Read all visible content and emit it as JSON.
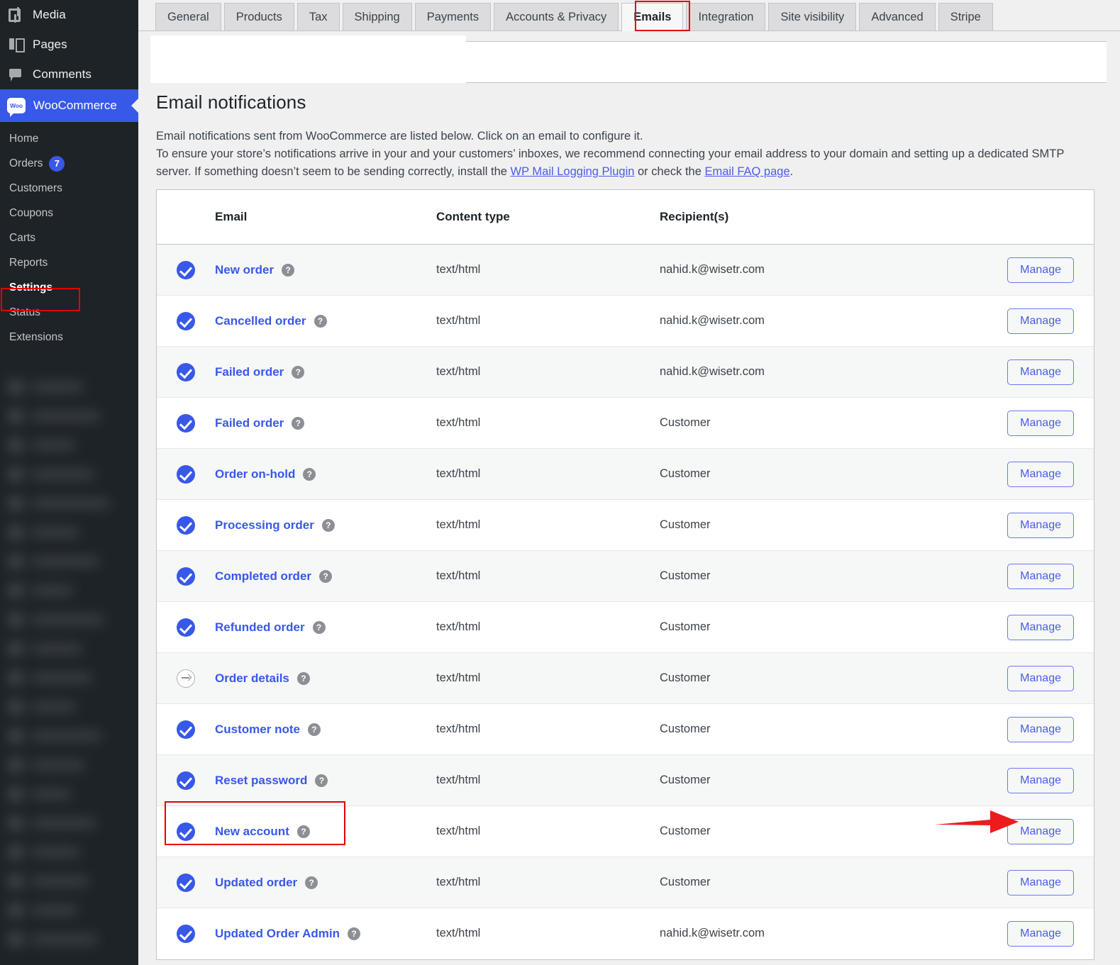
{
  "sidebar": {
    "top_items": [
      {
        "label": "Media",
        "icon": "media-icon"
      },
      {
        "label": "Pages",
        "icon": "pages-icon"
      },
      {
        "label": "Comments",
        "icon": "comments-icon"
      }
    ],
    "active_menu": {
      "label": "WooCommerce",
      "logo_text": "Woo",
      "icon": "woocommerce-logo-icon"
    },
    "submenu": [
      {
        "label": "Home",
        "badge": "",
        "current": false
      },
      {
        "label": "Orders",
        "badge": "7",
        "current": false
      },
      {
        "label": "Customers",
        "badge": "",
        "current": false
      },
      {
        "label": "Coupons",
        "badge": "",
        "current": false
      },
      {
        "label": "Carts",
        "badge": "",
        "current": false
      },
      {
        "label": "Reports",
        "badge": "",
        "current": false
      },
      {
        "label": "Settings",
        "badge": "",
        "current": true
      },
      {
        "label": "Status",
        "badge": "",
        "current": false
      },
      {
        "label": "Extensions",
        "badge": "",
        "current": false
      }
    ]
  },
  "tabs": [
    {
      "label": "General",
      "active": false
    },
    {
      "label": "Products",
      "active": false
    },
    {
      "label": "Tax",
      "active": false
    },
    {
      "label": "Shipping",
      "active": false
    },
    {
      "label": "Payments",
      "active": false
    },
    {
      "label": "Accounts & Privacy",
      "active": false
    },
    {
      "label": "Emails",
      "active": true
    },
    {
      "label": "Integration",
      "active": false
    },
    {
      "label": "Site visibility",
      "active": false
    },
    {
      "label": "Advanced",
      "active": false
    },
    {
      "label": "Stripe",
      "active": false
    }
  ],
  "main": {
    "title": "Email notifications",
    "desc_line1": "Email notifications sent from WooCommerce are listed below. Click on an email to configure it.",
    "desc_line2_a": "To ensure your store’s notifications arrive in your and your customers’ inboxes, we recommend connecting your email address to your domain and setting up a dedicated SMTP server. If something doesn’t seem to be sending correctly, install the ",
    "link_plugin": "WP Mail Logging Plugin",
    "desc_line2_b": " or check the ",
    "link_faq": "Email FAQ page",
    "desc_line2_c": "."
  },
  "table": {
    "headers": {
      "status": "",
      "email": "Email",
      "content_type": "Content type",
      "recipients": "Recipient(s)",
      "action": ""
    },
    "manage_label": "Manage",
    "help_glyph": "?",
    "rows": [
      {
        "status": "enabled",
        "email": "New order",
        "content_type": "text/html",
        "recipient": "nahid.k@wisetr.com",
        "action": "Manage",
        "highlighted": false
      },
      {
        "status": "enabled",
        "email": "Cancelled order",
        "content_type": "text/html",
        "recipient": "nahid.k@wisetr.com",
        "action": "Manage",
        "highlighted": false
      },
      {
        "status": "enabled",
        "email": "Failed order",
        "content_type": "text/html",
        "recipient": "nahid.k@wisetr.com",
        "action": "Manage",
        "highlighted": false
      },
      {
        "status": "enabled",
        "email": "Failed order",
        "content_type": "text/html",
        "recipient": "Customer",
        "action": "Manage",
        "highlighted": false
      },
      {
        "status": "enabled",
        "email": "Order on-hold",
        "content_type": "text/html",
        "recipient": "Customer",
        "action": "Manage",
        "highlighted": false
      },
      {
        "status": "enabled",
        "email": "Processing order",
        "content_type": "text/html",
        "recipient": "Customer",
        "action": "Manage",
        "highlighted": false
      },
      {
        "status": "enabled",
        "email": "Completed order",
        "content_type": "text/html",
        "recipient": "Customer",
        "action": "Manage",
        "highlighted": false
      },
      {
        "status": "enabled",
        "email": "Refunded order",
        "content_type": "text/html",
        "recipient": "Customer",
        "action": "Manage",
        "highlighted": false
      },
      {
        "status": "manual",
        "email": "Order details",
        "content_type": "text/html",
        "recipient": "Customer",
        "action": "Manage",
        "highlighted": false
      },
      {
        "status": "enabled",
        "email": "Customer note",
        "content_type": "text/html",
        "recipient": "Customer",
        "action": "Manage",
        "highlighted": false
      },
      {
        "status": "enabled",
        "email": "Reset password",
        "content_type": "text/html",
        "recipient": "Customer",
        "action": "Manage",
        "highlighted": false
      },
      {
        "status": "enabled",
        "email": "New account",
        "content_type": "text/html",
        "recipient": "Customer",
        "action": "Manage",
        "highlighted": true
      },
      {
        "status": "enabled",
        "email": "Updated order",
        "content_type": "text/html",
        "recipient": "Customer",
        "action": "Manage",
        "highlighted": false
      },
      {
        "status": "enabled",
        "email": "Updated Order Admin",
        "content_type": "text/html",
        "recipient": "nahid.k@wisetr.com",
        "action": "Manage",
        "highlighted": false
      }
    ]
  },
  "colors": {
    "accent_blue": "#3858e9",
    "annotation_red": "#e60000",
    "sidebar_bg": "#1d2327",
    "page_bg": "#f0f0f1"
  }
}
